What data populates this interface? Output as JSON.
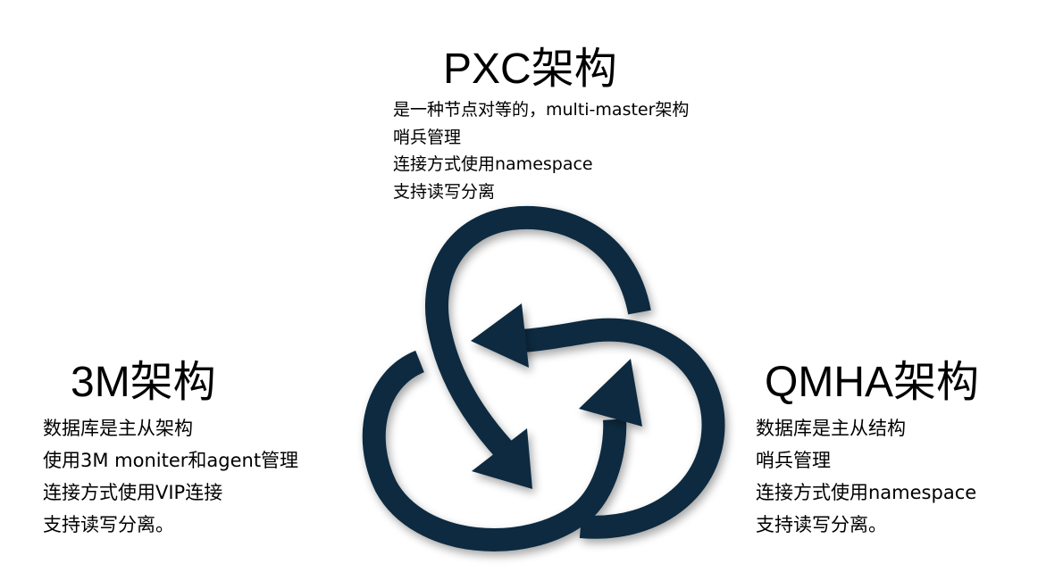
{
  "pxc": {
    "title": "PXC架构",
    "lines": [
      "是一种节点对等的，multi-master架构",
      "哨兵管理",
      "连接方式使用namespace",
      "支持读写分离"
    ]
  },
  "m3": {
    "title": "3M架构",
    "lines": [
      "数据库是主从架构",
      "使用3M moniter和agent管理",
      "连接方式使用VIP连接",
      "支持读写分离。"
    ]
  },
  "qmha": {
    "title": "QMHA架构",
    "lines": [
      "数据库是主从结构",
      "哨兵管理",
      "连接方式使用namespace",
      "支持读写分离。"
    ]
  },
  "colors": {
    "knot": "#0d2a3f",
    "text": "#000000"
  },
  "icons": {
    "center": "triquetra-cycle-arrows-icon"
  }
}
